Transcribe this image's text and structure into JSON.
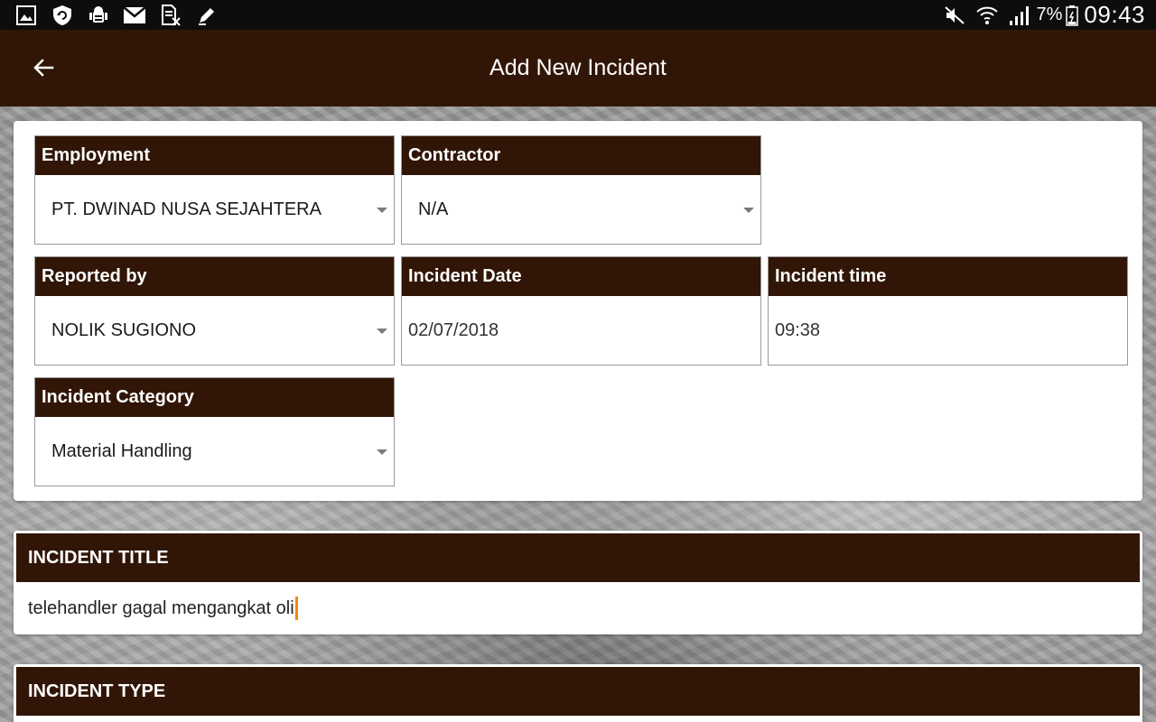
{
  "status_bar": {
    "left_icons": [
      "gallery-icon",
      "shield-refresh-icon",
      "android-debug-icon",
      "gmail-icon",
      "file-excel-icon",
      "pencil-icon"
    ],
    "right_icons": [
      "mute-icon",
      "wifi-icon",
      "signal-icon"
    ],
    "battery_percent": "7%",
    "time": "09:43"
  },
  "appbar": {
    "title": "Add New Incident",
    "back_icon": "arrow-left-icon"
  },
  "form": {
    "employment": {
      "label": "Employment",
      "value": "PT. DWINAD NUSA SEJAHTERA"
    },
    "contractor": {
      "label": "Contractor",
      "value": "N/A"
    },
    "reported_by": {
      "label": "Reported by",
      "value": "NOLIK SUGIONO"
    },
    "incident_date": {
      "label": "Incident Date",
      "value": "02/07/2018"
    },
    "incident_time": {
      "label": "Incident time",
      "value": "09:38"
    },
    "incident_category": {
      "label": "Incident Category",
      "value": "Material Handling"
    }
  },
  "incident_title": {
    "label": "INCIDENT TITLE",
    "value": "telehandler gagal mengangkat oli"
  },
  "incident_type": {
    "label": "INCIDENT TYPE"
  },
  "colors": {
    "header_brown": "#311607",
    "cursor_orange": "#f08a00"
  }
}
